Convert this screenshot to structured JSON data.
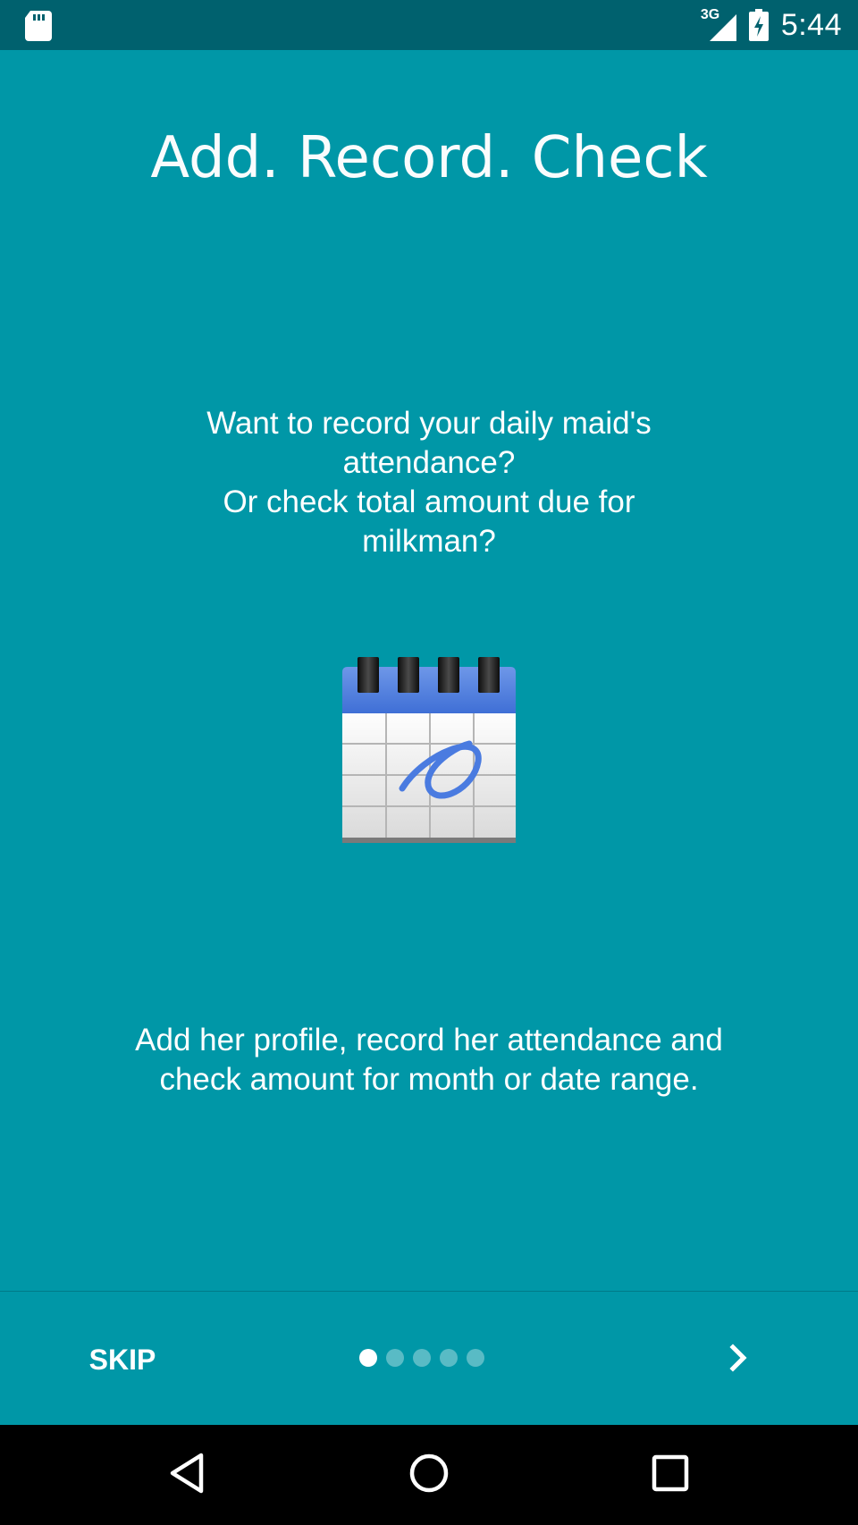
{
  "status_bar": {
    "left_icon": "sd-card-icon",
    "network_label": "3G",
    "signal_icon": "signal-icon",
    "battery_icon": "battery-charging-icon",
    "time": "5:44"
  },
  "onboarding": {
    "title": "Add. Record. Check",
    "subtitle": "Want to record your daily maid's attendance?\nOr check total amount due for milkman?",
    "illustration_icon": "calendar-icon",
    "description": "Add her profile, record her attendance and check amount for month or date range.",
    "skip_label": "SKIP",
    "next_icon": "chevron-right-icon",
    "page_count": 5,
    "current_page": 1
  },
  "system_nav": {
    "back_icon": "back-icon",
    "home_icon": "home-icon",
    "recents_icon": "recents-icon"
  },
  "colors": {
    "background": "#0097A7",
    "status_bar": "#00616E",
    "nav_bar": "#000000",
    "text": "#FFFFFF"
  }
}
